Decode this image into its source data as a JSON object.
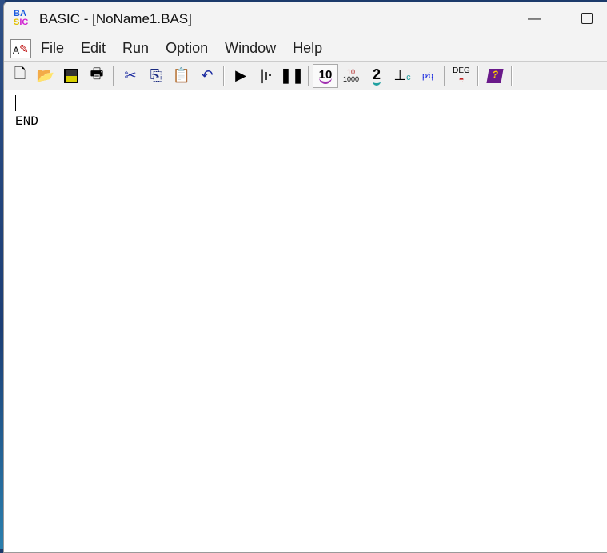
{
  "window": {
    "title": "BASIC - [NoName1.BAS]",
    "logo_text": "BASIC"
  },
  "menu": [
    "File",
    "Edit",
    "Run",
    "Option",
    "Window",
    "Help"
  ],
  "toolbar": {
    "file": [
      "new-icon",
      "open-icon",
      "save-icon",
      "print-icon"
    ],
    "edit": [
      "cut-icon",
      "copy-icon",
      "paste-icon",
      "undo-icon"
    ],
    "run": [
      "run-icon",
      "step-icon",
      "pause-icon"
    ],
    "modes": [
      "decimal-icon",
      "scientific-icon",
      "binary-icon",
      "complex-icon",
      "fraction-icon"
    ],
    "deg_label": "DEG",
    "help": "help-book-icon"
  },
  "editor": {
    "lines": [
      "",
      "END"
    ]
  }
}
